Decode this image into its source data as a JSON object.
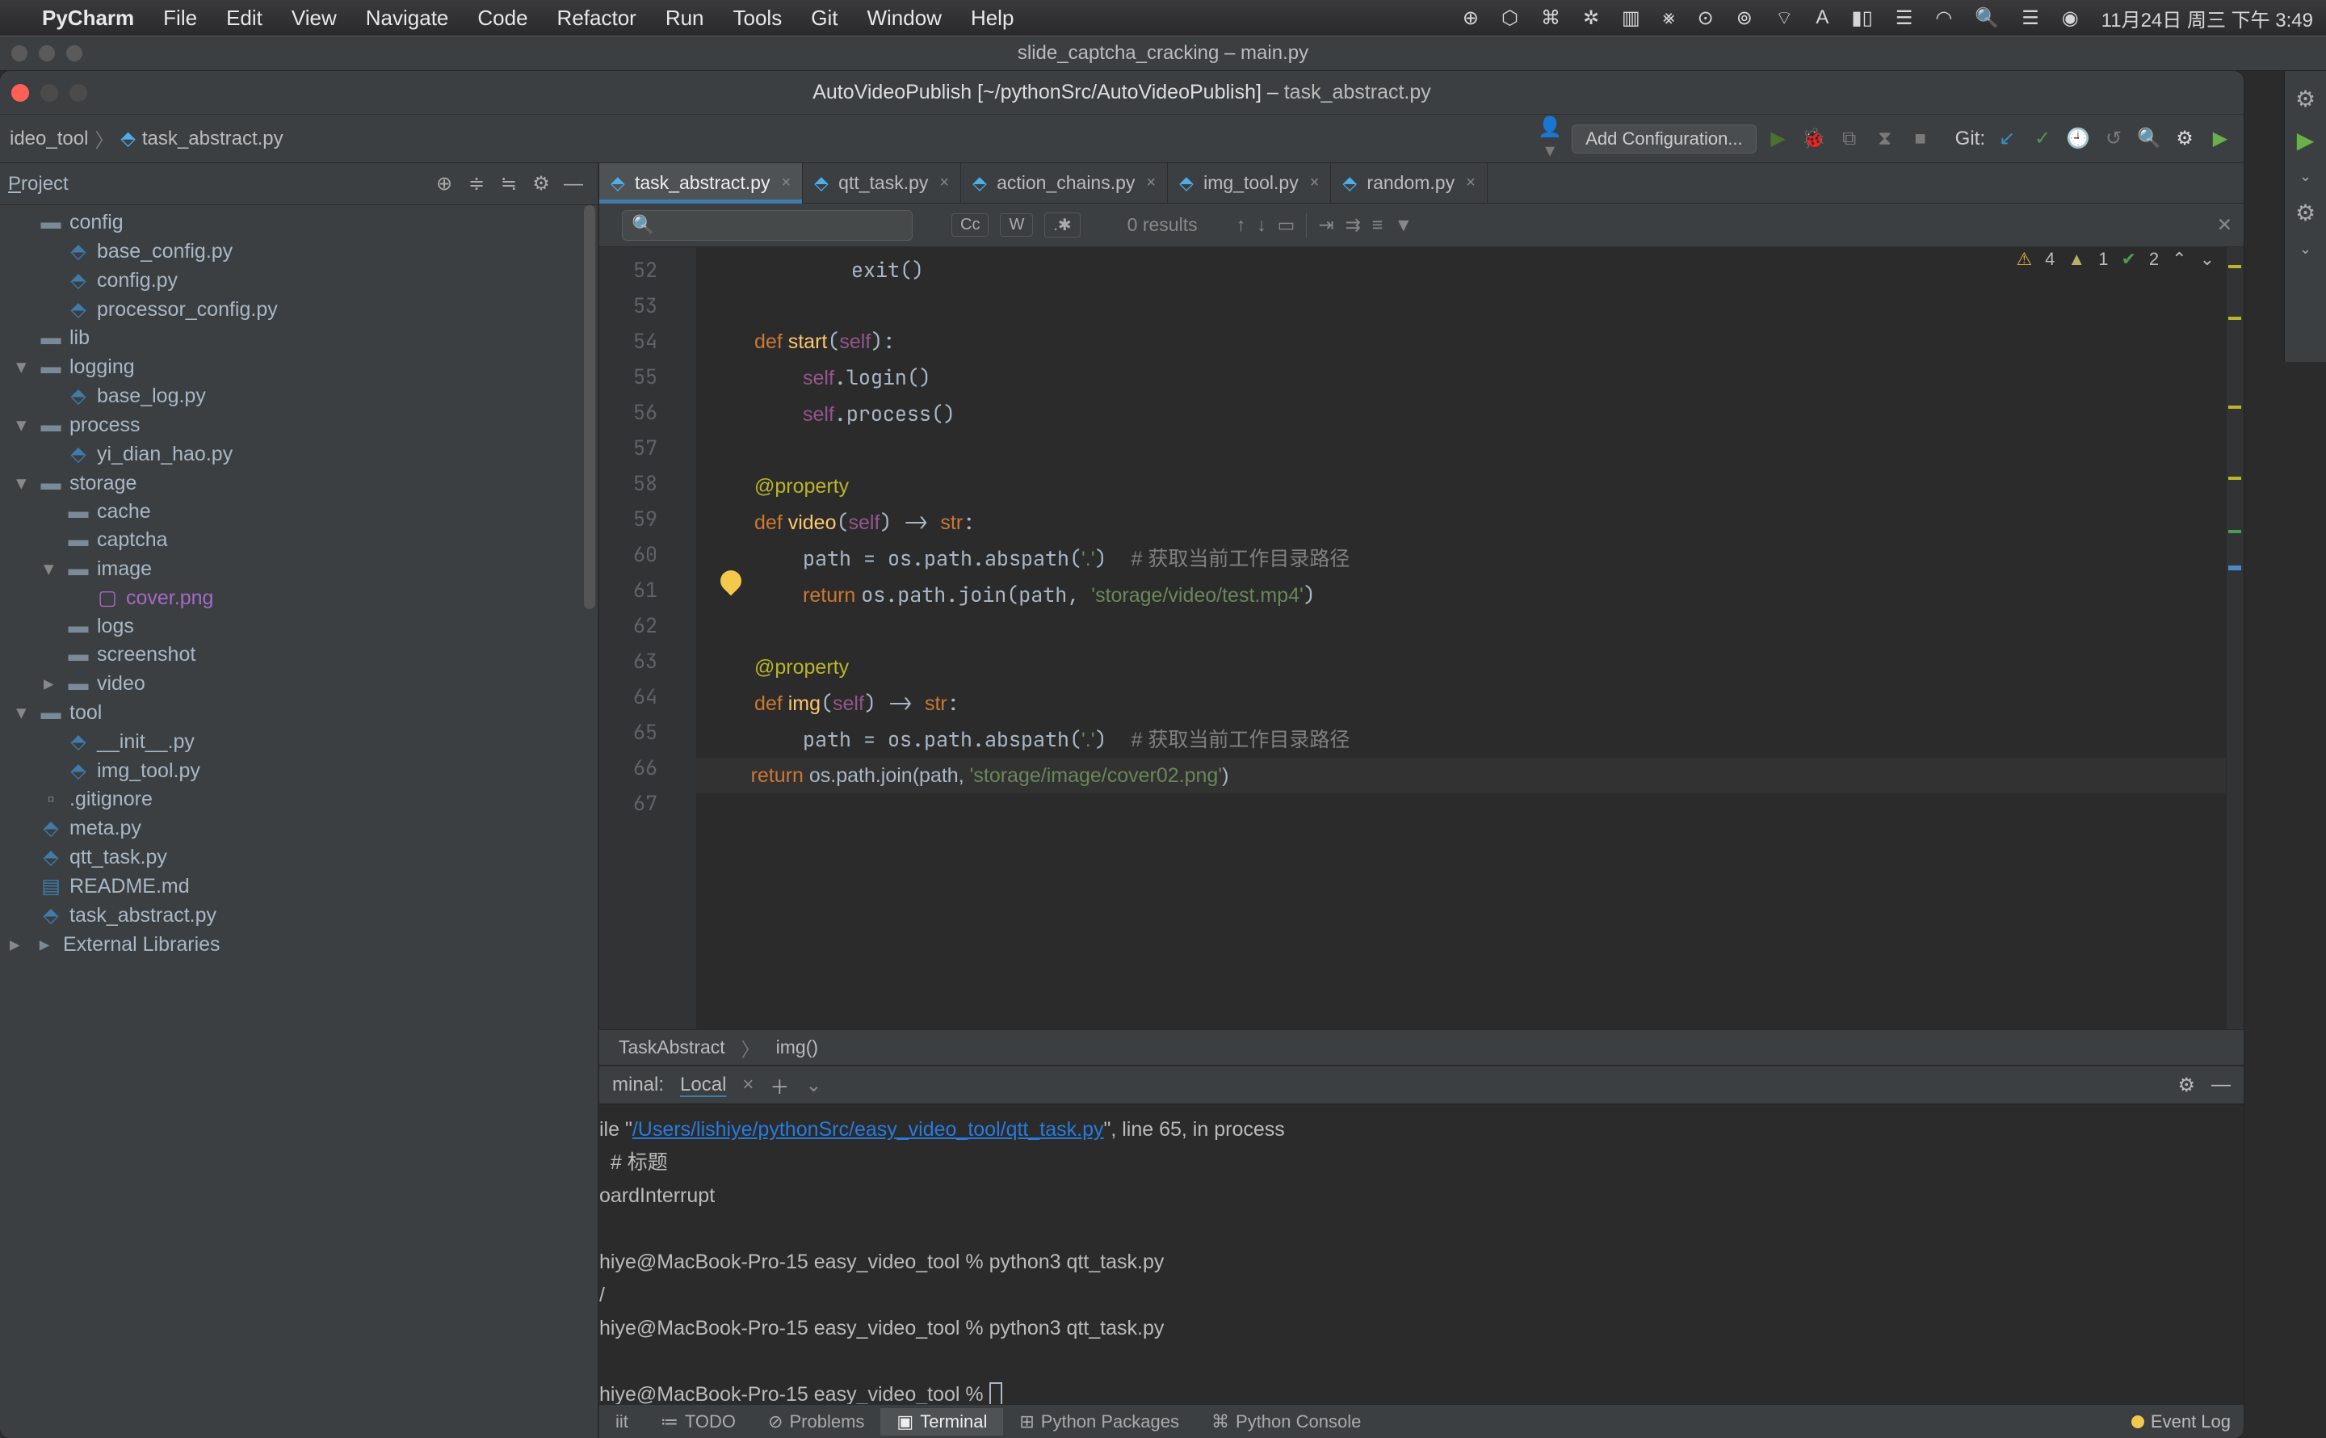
{
  "menubar": {
    "app": "PyCharm",
    "items": [
      "File",
      "Edit",
      "View",
      "Navigate",
      "Code",
      "Refactor",
      "Run",
      "Tools",
      "Git",
      "Window",
      "Help"
    ],
    "clock": "11月24日 周三 下午 3:49"
  },
  "bg_window_title": "slide_captcha_cracking – main.py",
  "ide_title": {
    "prefix": "AutoVideoPublish [~/pythonSrc/AutoVideoPublish] – ",
    "file": "task_abstract.py"
  },
  "crumbs": [
    "ideo_tool",
    "task_abstract.py"
  ],
  "run_config_btn": "Add Configuration...",
  "git_label": "Git:",
  "project": {
    "title": "Project",
    "tree": [
      {
        "d": 1,
        "t": "dir",
        "arrow": "",
        "name": "config"
      },
      {
        "d": 2,
        "t": "py",
        "name": "base_config.py"
      },
      {
        "d": 2,
        "t": "py",
        "name": "config.py"
      },
      {
        "d": 2,
        "t": "py",
        "name": "processor_config.py"
      },
      {
        "d": 1,
        "t": "dir",
        "arrow": "",
        "name": "lib"
      },
      {
        "d": 1,
        "t": "dir",
        "arrow": "▾",
        "name": "logging"
      },
      {
        "d": 2,
        "t": "py",
        "name": "base_log.py"
      },
      {
        "d": 1,
        "t": "dir",
        "arrow": "▾",
        "name": "process"
      },
      {
        "d": 2,
        "t": "py",
        "name": "yi_dian_hao.py"
      },
      {
        "d": 1,
        "t": "dir",
        "arrow": "▾",
        "name": "storage"
      },
      {
        "d": 2,
        "t": "dir",
        "arrow": "",
        "name": "cache"
      },
      {
        "d": 2,
        "t": "dir",
        "arrow": "",
        "name": "captcha"
      },
      {
        "d": 2,
        "t": "dir",
        "arrow": "▾",
        "name": "image"
      },
      {
        "d": 3,
        "t": "img",
        "name": "cover.png"
      },
      {
        "d": 2,
        "t": "dir",
        "arrow": "",
        "name": "logs"
      },
      {
        "d": 2,
        "t": "dir",
        "arrow": "",
        "name": "screenshot"
      },
      {
        "d": 2,
        "t": "dir",
        "arrow": "▸",
        "name": "video"
      },
      {
        "d": 1,
        "t": "dir",
        "arrow": "▾",
        "name": "tool"
      },
      {
        "d": 2,
        "t": "py",
        "name": "__init__.py"
      },
      {
        "d": 2,
        "t": "py",
        "name": "img_tool.py"
      },
      {
        "d": 1,
        "t": "file",
        "name": ".gitignore"
      },
      {
        "d": 1,
        "t": "py",
        "name": "meta.py"
      },
      {
        "d": 1,
        "t": "py",
        "name": "qtt_task.py"
      },
      {
        "d": 1,
        "t": "md",
        "name": "README.md"
      },
      {
        "d": 1,
        "t": "py",
        "name": "task_abstract.py"
      },
      {
        "d": 0,
        "t": "lib",
        "arrow": "▸",
        "name": "External Libraries"
      }
    ]
  },
  "tabs": [
    {
      "name": "task_abstract.py",
      "active": true
    },
    {
      "name": "qtt_task.py"
    },
    {
      "name": "action_chains.py"
    },
    {
      "name": "img_tool.py"
    },
    {
      "name": "random.py"
    }
  ],
  "find": {
    "placeholder": "",
    "results": "0 results",
    "cc": "Cc",
    "w": "W"
  },
  "inspections": {
    "warn": "4",
    "weak": "1",
    "ok": "2"
  },
  "lines": [
    "52",
    "53",
    "54",
    "55",
    "56",
    "57",
    "58",
    "59",
    "60",
    "61",
    "62",
    "63",
    "64",
    "65",
    "66",
    "67"
  ],
  "breadcrumb": {
    "cls": "TaskAbstract",
    "fn": "img()"
  },
  "terminal": {
    "label": "minal:",
    "tab": "Local",
    "lines": {
      "l1a": "ile \"",
      "l1link": "/Users/lishiye/pythonSrc/easy_video_tool/qtt_task.py",
      "l1b": "\", line 65, in process",
      "l2": "  # 标题",
      "l3": "oardInterrupt",
      "l4": "",
      "l5": "hiye@MacBook-Pro-15 easy_video_tool % python3 qtt_task.py",
      "l6": "/",
      "l7": "hiye@MacBook-Pro-15 easy_video_tool % python3 qtt_task.py",
      "l8": "",
      "l9": "hiye@MacBook-Pro-15 easy_video_tool % "
    }
  },
  "bottom": {
    "git": "iit",
    "todo": "TODO",
    "problems": "Problems",
    "terminal": "Terminal",
    "pkgs": "Python Packages",
    "console": "Python Console",
    "event": "Event Log"
  }
}
